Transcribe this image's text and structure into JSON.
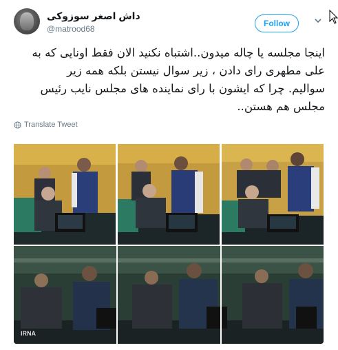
{
  "author": {
    "name": "داش اصغر سوزوکی",
    "handle": "@matrood68"
  },
  "follow_button": {
    "label": "Follow",
    "color": "#1da1f2"
  },
  "icons": [
    "chevron-down-icon",
    "globe-icon",
    "mouse-cursor-icon"
  ],
  "tweet": {
    "lines": [
      "اینجا مجلسه یا چاله میدون..اشتباه نکنید الان فقط اونایی که به",
      "علی مطهری رای دادن ، زیر سوال نیستن بلکه همه زیر",
      "سوالیم. چرا که ایشون با رای نماینده های مجلس نایب رئیس",
      "مجلس هم هستن.."
    ]
  },
  "translate_label": "Translate Tweet",
  "media": {
    "watermark": "IRNA"
  }
}
